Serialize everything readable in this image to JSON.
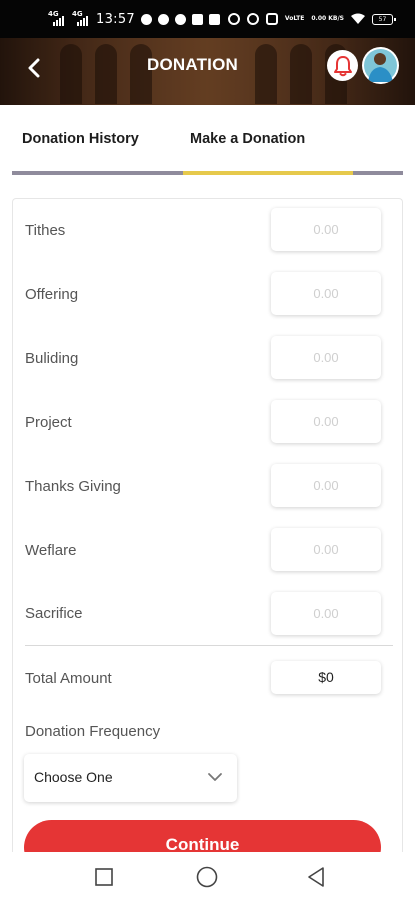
{
  "status_bar": {
    "time": "13:57",
    "network_1": "4G",
    "network_2": "4G",
    "volte_text": "VoLTE",
    "speed_text": "0.00 KB/S",
    "battery": "57"
  },
  "header": {
    "title": "DONATION",
    "back_icon": "chevron-left-icon",
    "bell_icon": "bell-icon"
  },
  "tabs": [
    {
      "label": "Donation History",
      "active": false
    },
    {
      "label": "Make a Donation",
      "active": true
    }
  ],
  "donation_rows": [
    {
      "label": "Tithes",
      "placeholder": "0.00"
    },
    {
      "label": "Offering",
      "placeholder": "0.00"
    },
    {
      "label": "Buliding",
      "placeholder": "0.00"
    },
    {
      "label": "Project",
      "placeholder": "0.00"
    },
    {
      "label": "Thanks Giving",
      "placeholder": "0.00"
    },
    {
      "label": "Weflare",
      "placeholder": "0.00"
    },
    {
      "label": "Sacrifice",
      "placeholder": "0.00"
    }
  ],
  "total": {
    "label": "Total Amount",
    "value": "$0"
  },
  "frequency": {
    "label": "Donation Frequency",
    "selected": "Choose One"
  },
  "continue_label": "Continue",
  "colors": {
    "accent_red": "#e53535",
    "tab_active": "#e6c94c",
    "tab_inactive": "#8f8b9c"
  }
}
